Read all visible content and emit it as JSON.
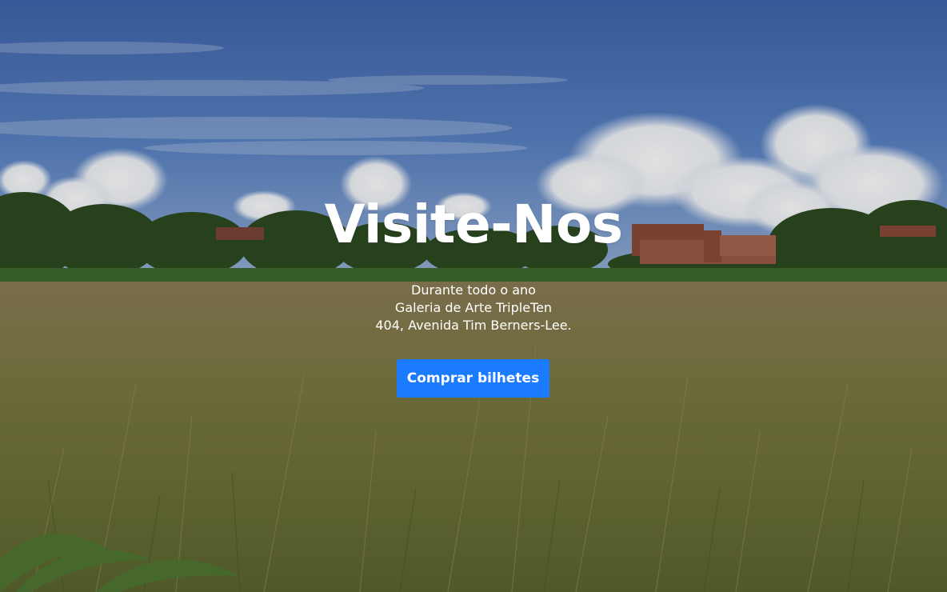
{
  "hero": {
    "title": "Visite-Nos",
    "info": [
      "Durante todo o ano",
      "Galeria de Arte TripleTen",
      "404, Avenida Tim Berners-Lee."
    ],
    "button_label": "Comprar bilhetes"
  },
  "colors": {
    "button": "#1a7bff",
    "text": "#ffffff",
    "sky": "#4a72b8",
    "grass": "#7a7a3c"
  }
}
